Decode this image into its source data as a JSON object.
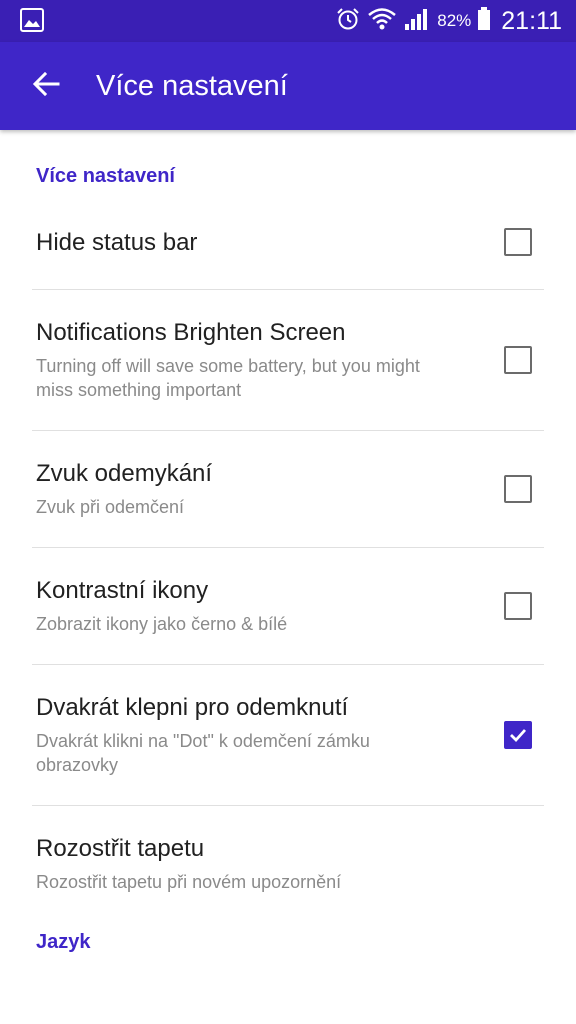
{
  "status_bar": {
    "battery_percent": "82%",
    "time": "21:11",
    "icons": [
      "gallery-icon",
      "alarm-icon",
      "wifi-icon",
      "signal-icon",
      "battery-icon"
    ]
  },
  "toolbar": {
    "title": "Více nastavení",
    "back_icon": "arrow-left-icon"
  },
  "sections": {
    "more_settings": {
      "header": "Více nastavení",
      "items": [
        {
          "title": "Hide status bar",
          "summary": "",
          "checked": false
        },
        {
          "title": "Notifications Brighten Screen",
          "summary": "Turning off will save some battery, but you might miss something important",
          "checked": false
        },
        {
          "title": "Zvuk odemykání",
          "summary": "Zvuk při odemčení",
          "checked": false
        },
        {
          "title": "Kontrastní ikony",
          "summary": "Zobrazit ikony jako černo & bílé",
          "checked": false
        },
        {
          "title": "Dvakrát klepni pro odemknutí",
          "summary": "Dvakrát klikni na \"Dot\" k odemčení zámku obrazovky",
          "checked": true
        },
        {
          "title": "Rozostřit tapetu",
          "summary": "Rozostřit tapetu při novém upozornění"
        }
      ]
    },
    "language": {
      "header": "Jazyk"
    }
  },
  "colors": {
    "status_bar": "#3a1fb4",
    "toolbar": "#3f26c8",
    "accent": "#3f26c8"
  }
}
